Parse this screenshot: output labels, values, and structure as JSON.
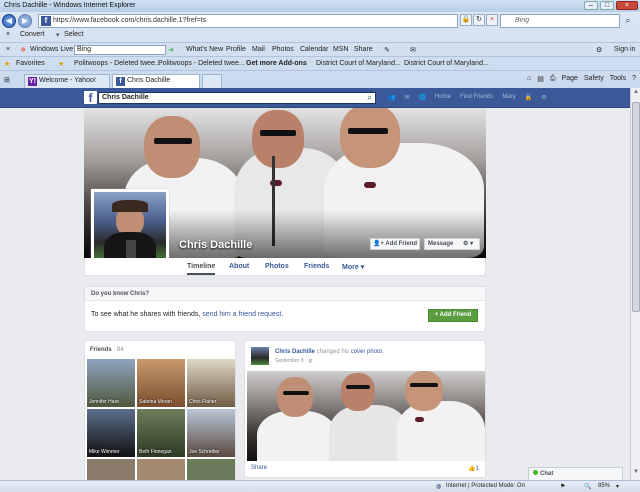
{
  "window": {
    "title": "Chris Dachille - Windows Internet Explorer",
    "min": "–",
    "max": "□",
    "close": "×"
  },
  "address": {
    "url": "https://www.facebook.com/chris.dachille.1?fref=ts",
    "search_placeholder": "Bing"
  },
  "menubar": {
    "convert": "Convert",
    "select": "Select"
  },
  "windows_live": {
    "label": "Windows Live",
    "search_value": "Bing",
    "links": [
      "What's New",
      "Profile",
      "Mail",
      "Photos",
      "Calendar",
      "MSN",
      "Share"
    ],
    "sign_in": "Sign in"
  },
  "favorites": {
    "label": "Favorites",
    "items": [
      "Politwoops - Deleted twee...",
      "Politwoops - Deleted twee...",
      "Get more Add-ons",
      "District Court of Maryland...",
      "District Court of Maryland..."
    ]
  },
  "tabs": [
    {
      "label": "Welcome - Yahoo! Profile"
    },
    {
      "label": "Chris Dachille"
    }
  ],
  "commandbar": {
    "page": "Page",
    "safety": "Safety",
    "tools": "Tools",
    "help": "?"
  },
  "fb": {
    "logo": "f",
    "search_value": "Chris Dachille",
    "nav": {
      "home": "Home",
      "find_friends": "Find Friends",
      "user": "Mary"
    },
    "profile_name": "Chris Dachille",
    "add_friend": "Add Friend",
    "message": "Message",
    "profile_tabs": [
      "Timeline",
      "About",
      "Photos",
      "Friends",
      "More"
    ],
    "know": {
      "heading": "Do you know Chris?",
      "text_before": "To see what he shares with friends, ",
      "link": "send him a friend request",
      "text_after": ".",
      "button": "Add Friend"
    },
    "friends": {
      "heading": "Friends",
      "count": "· 84",
      "people": [
        {
          "name": "Jennifer Hare"
        },
        {
          "name": "Sabrina Moran"
        },
        {
          "name": "Chris Flaher"
        },
        {
          "name": "Mike Wimmer"
        },
        {
          "name": "Beth Finnegan"
        },
        {
          "name": "Joe Schreiber"
        }
      ]
    },
    "post": {
      "author": "Chris Dachille",
      "action": " changed his ",
      "object": "cover photo",
      "end": ".",
      "date": "September 8 · ",
      "share": "Share",
      "likes": "1"
    },
    "chat": "Chat"
  },
  "status": {
    "zone": "Internet | Protected Mode: On",
    "zoom": "85%"
  },
  "colors": {
    "fb_blue": "#3b5998",
    "fb_green": "#5b9c41",
    "link": "#365899"
  }
}
